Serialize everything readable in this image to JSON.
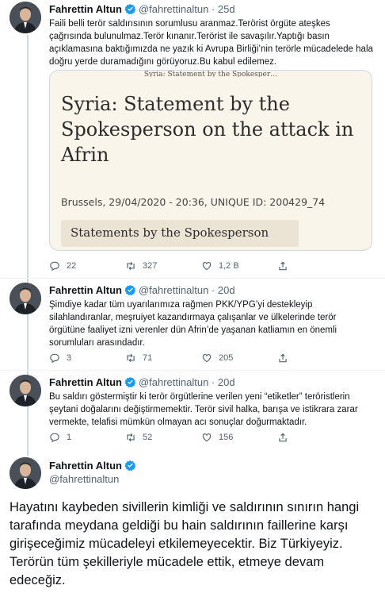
{
  "colors": {
    "verified": "#1d9bf0",
    "text": "#0f1419",
    "muted": "#536471",
    "line": "#cfd9de"
  },
  "tweets": [
    {
      "name": "Fahrettin Altun",
      "handle": "@fahrettinaltun",
      "time": "25d",
      "text": "Faili belli terör saldırısının sorumlusu aranmaz.Terörist örgüte ateşkes çağrısında bulunulmaz.Terör kınanır.Terörist ile savaşılır.Yaptığı basın açıklamasına baktığımızda ne yazık ki Avrupa Birliği’nin terörle mücadelede hala doğru yerde duramadığını görüyoruz.Bu kabul edilemez.",
      "card": {
        "top_text": "Syria: Statement by the Spokesper…",
        "title": "Syria: Statement by the Spokesperson on the attack in Afrin",
        "meta": "Brussels, 29/04/2020 - 20:36, UNIQUE ID: 200429_74",
        "pill": "Statements by the Spokesperson"
      },
      "replies": "22",
      "retweets": "327",
      "likes": "1,2 B"
    },
    {
      "name": "Fahrettin Altun",
      "handle": "@fahrettinaltun",
      "time": "20d",
      "text": "Şimdiye kadar tüm uyarılarımıza rağmen PKK/YPG’yi destekleyip silahlandıranlar, meşruiyet kazandırmaya çalışanlar ve ülkelerinde terör örgütüne faaliyet izni verenler dün Afrin’de yaşanan katliamın en önemli sorumluları arasındadır.",
      "replies": "3",
      "retweets": "71",
      "likes": "205"
    },
    {
      "name": "Fahrettin Altun",
      "handle": "@fahrettinaltun",
      "time": "20d",
      "text": "Bu saldırı göstermiştir ki terör örgütlerine verilen yeni “etiketler” teröristlerin şeytani doğalarını  değiştirmemektir. Terör sivil halka, barışa ve istikrara zarar vermekte, telafisi mümkün olmayan acı sonuçlar doğurmaktadır.",
      "replies": "1",
      "retweets": "52",
      "likes": "156"
    }
  ],
  "main_tweet": {
    "name": "Fahrettin Altun",
    "handle": "@fahrettinaltun",
    "text": "Hayatını kaybeden sivillerin kimliği ve saldırının sınırın hangi tarafında meydana geldiği bu hain saldırının faillerine karşı girişeceğimiz mücadeleyi etkilemeyecektir. Biz Türkiyeyiz. Terörün tüm şekilleriyle mücadele ettik, etmeye devam edeceğiz."
  }
}
